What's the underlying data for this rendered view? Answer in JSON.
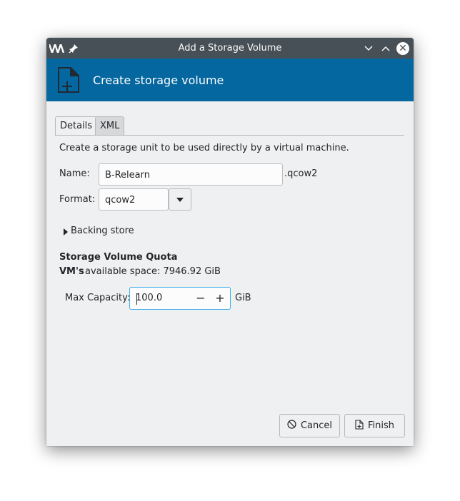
{
  "window": {
    "title": "Add a Storage Volume"
  },
  "banner": {
    "heading": "Create storage volume"
  },
  "tabs": [
    {
      "label": "Details",
      "active": true
    },
    {
      "label": "XML",
      "active": false
    }
  ],
  "details": {
    "description": "Create a storage unit to be used directly by a virtual machine.",
    "name_label": "Name:",
    "name_value": "B-Relearn",
    "name_suffix": ".qcow2",
    "format_label": "Format:",
    "format_value": "qcow2",
    "backing_store_label": "Backing store",
    "quota_heading": "Storage Volume Quota",
    "space_owner": "VM's",
    "space_text": "available space: 7946.92 GiB",
    "max_capacity_label": "Max Capacity:",
    "max_capacity_value": "100.0",
    "max_capacity_unit": "GiB"
  },
  "buttons": {
    "cancel": "Cancel",
    "finish": "Finish"
  },
  "colors": {
    "banner": "#04679f",
    "titlebar": "#475057",
    "focus": "#3daee9"
  }
}
